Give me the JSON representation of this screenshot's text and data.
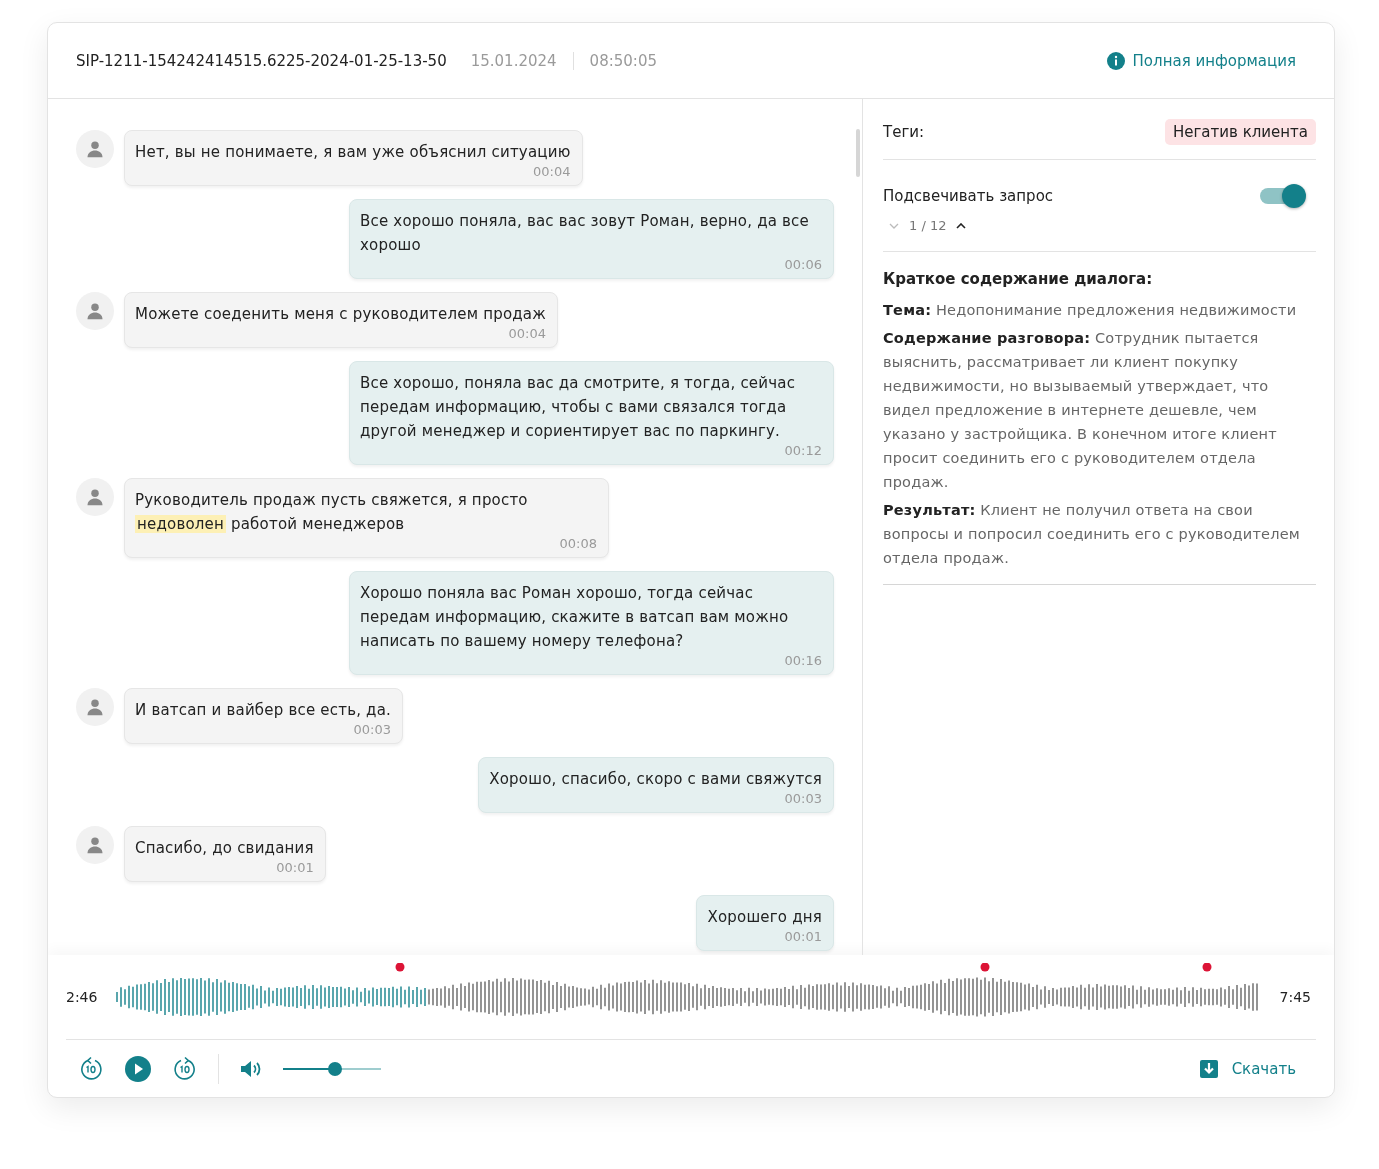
{
  "header": {
    "call_id": "SIP-1211-154242414515.6225-2024-01-25-13-50",
    "date": "15.01.2024",
    "time": "08:50:05",
    "info_link": "Полная информация"
  },
  "messages": [
    {
      "kind": "client",
      "text": "Нет, вы не понимаете, я вам уже объяснил ситуацию",
      "time": "00:04"
    },
    {
      "kind": "operator",
      "text": "Все хорошо поняла, вас вас зовут Роман, верно, да все хорошо",
      "time": "00:06"
    },
    {
      "kind": "client",
      "text": "Можете соеденить меня с руководителем продаж",
      "time": "00:04"
    },
    {
      "kind": "operator",
      "text": "Все хорошо, поняла вас да смотрите, я тогда, сейчас передам информацию, чтобы с вами связался тогда другой менеджер и сориентирует вас по паркингу.",
      "time": "00:12"
    },
    {
      "kind": "client",
      "parts": [
        {
          "text": "Руководитель продаж пусть свяжется, я просто ",
          "highlight": false
        },
        {
          "text": "недоволен",
          "highlight": true
        },
        {
          "text": " работой менеджеров",
          "highlight": false
        }
      ],
      "time": "00:08"
    },
    {
      "kind": "operator",
      "text": "Хорошо поняла вас Роман хорошо, тогда сейчас передам информацию, скажите в ватсап вам можно написать по вашему номеру телефона?",
      "time": "00:16"
    },
    {
      "kind": "client",
      "text": "И ватсап и вайбер все есть, да.",
      "time": "00:03"
    },
    {
      "kind": "operator",
      "text": "Хорошо, спасибо, скоро с вами свяжутся",
      "time": "00:03"
    },
    {
      "kind": "client",
      "text": "Спасибо, до свидания",
      "time": "00:01"
    },
    {
      "kind": "operator",
      "text": "Хорошего дня",
      "time": "00:01"
    }
  ],
  "side": {
    "tags_label": "Теги:",
    "tags": [
      {
        "label": "Негатив клиента",
        "color": "#fde3e5"
      }
    ],
    "highlight": {
      "label": "Подсвечивать запрос",
      "on": true,
      "counter": "1 / 12"
    },
    "summary": {
      "title": "Краткое содержание диалога:",
      "paragraphs": [
        "**Тема:** Недопонимание предложения недвижимости",
        "**Содержание разговора:** Сотрудник пытается выяснить, рассматривает ли клиент покупку недвижимости, но вызываемый утверждает, что видел предложение в интернете дешевле, чем указано у застройщика. В конечном итоге клиент просит соединить его с руководителем отдела продаж.",
        "**Результат:** Клиент не получил ответа на свои вопросы и попросил соединить его с руководителем отдела продаж."
      ]
    }
  },
  "player": {
    "start": "2:46",
    "end": "7:45",
    "level": 0.27,
    "volume": {
      "level": 0.53
    },
    "download": "Скачать"
  }
}
